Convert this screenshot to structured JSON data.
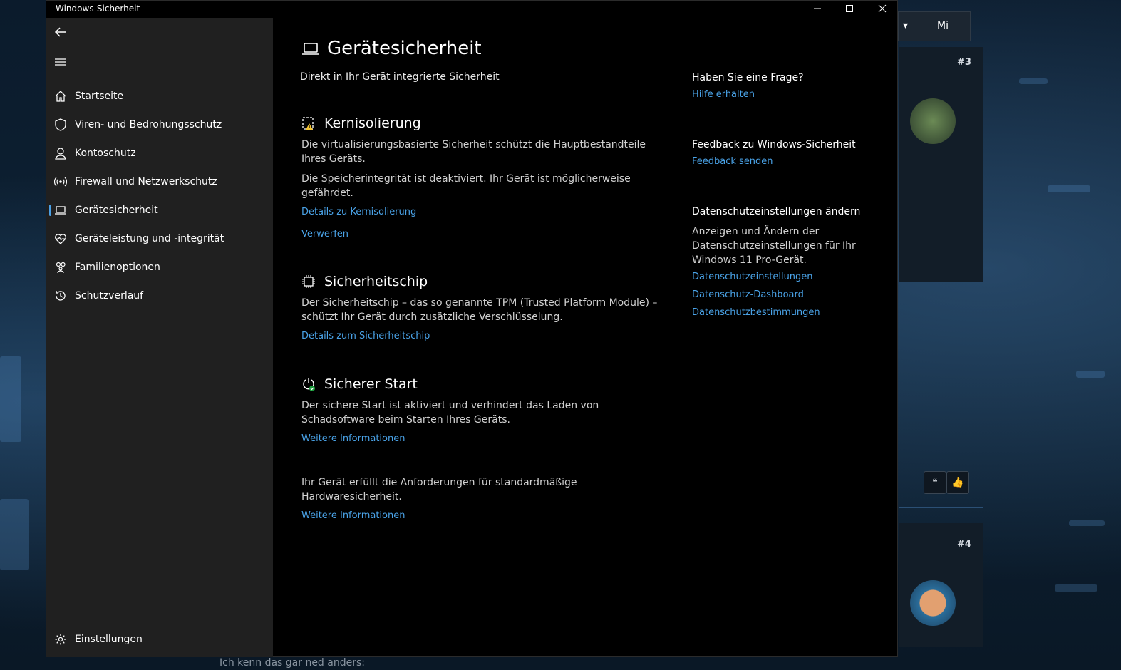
{
  "window": {
    "title": "Windows-Sicherheit"
  },
  "background": {
    "top_label": "Mi",
    "post3": "#3",
    "post4": "#4",
    "bottom_text": "Ich kenn das gar ned anders:"
  },
  "sidebar": {
    "items": [
      {
        "label": "Startseite",
        "icon": "home-icon"
      },
      {
        "label": "Viren- und Bedrohungsschutz",
        "icon": "shield-icon"
      },
      {
        "label": "Kontoschutz",
        "icon": "person-icon"
      },
      {
        "label": "Firewall und Netzwerkschutz",
        "icon": "antenna-icon"
      },
      {
        "label": "Gerätesicherheit",
        "icon": "laptop-icon",
        "active": true
      },
      {
        "label": "Geräteleistung und -integrität",
        "icon": "heart-icon"
      },
      {
        "label": "Familienoptionen",
        "icon": "family-icon"
      },
      {
        "label": "Schutzverlauf",
        "icon": "history-icon"
      }
    ],
    "settings_label": "Einstellungen"
  },
  "main": {
    "title": "Gerätesicherheit",
    "subtitle": "Direkt in Ihr Gerät integrierte Sicherheit",
    "core_isolation": {
      "title": "Kernisolierung",
      "p1": "Die virtualisierungsbasierte Sicherheit schützt die Hauptbestandteile Ihres Geräts.",
      "p2": "Die Speicherintegrität ist deaktiviert. Ihr Gerät ist möglicherweise gefährdet.",
      "link_details": "Details zu Kernisolierung",
      "link_dismiss": "Verwerfen"
    },
    "security_chip": {
      "title": "Sicherheitschip",
      "p1": "Der Sicherheitschip – das so genannte TPM (Trusted Platform Module) – schützt Ihr Gerät durch zusätzliche Verschlüsselung.",
      "link": "Details zum Sicherheitschip"
    },
    "secure_boot": {
      "title": "Sicherer Start",
      "p1": "Der sichere Start ist aktiviert und verhindert das Laden von Schadsoftware beim Starten Ihres Geräts.",
      "link": "Weitere Informationen"
    },
    "hardware": {
      "p1": "Ihr Gerät erfüllt die Anforderungen für standardmäßige Hardwaresicherheit.",
      "link": "Weitere Informationen"
    }
  },
  "right": {
    "question_title": "Haben Sie eine Frage?",
    "help_link": "Hilfe erhalten",
    "feedback_title": "Feedback zu Windows-Sicherheit",
    "feedback_link": "Feedback senden",
    "privacy_title": "Datenschutzeinstellungen ändern",
    "privacy_text": "Anzeigen und Ändern der Datenschutzeinstellungen für Ihr Windows 11 Pro-Gerät.",
    "privacy_links": [
      "Datenschutzeinstellungen",
      "Datenschutz-Dashboard",
      "Datenschutzbestimmungen"
    ]
  },
  "colors": {
    "accent": "#4aa3e8",
    "sidebar": "#202020",
    "content": "#000000"
  }
}
